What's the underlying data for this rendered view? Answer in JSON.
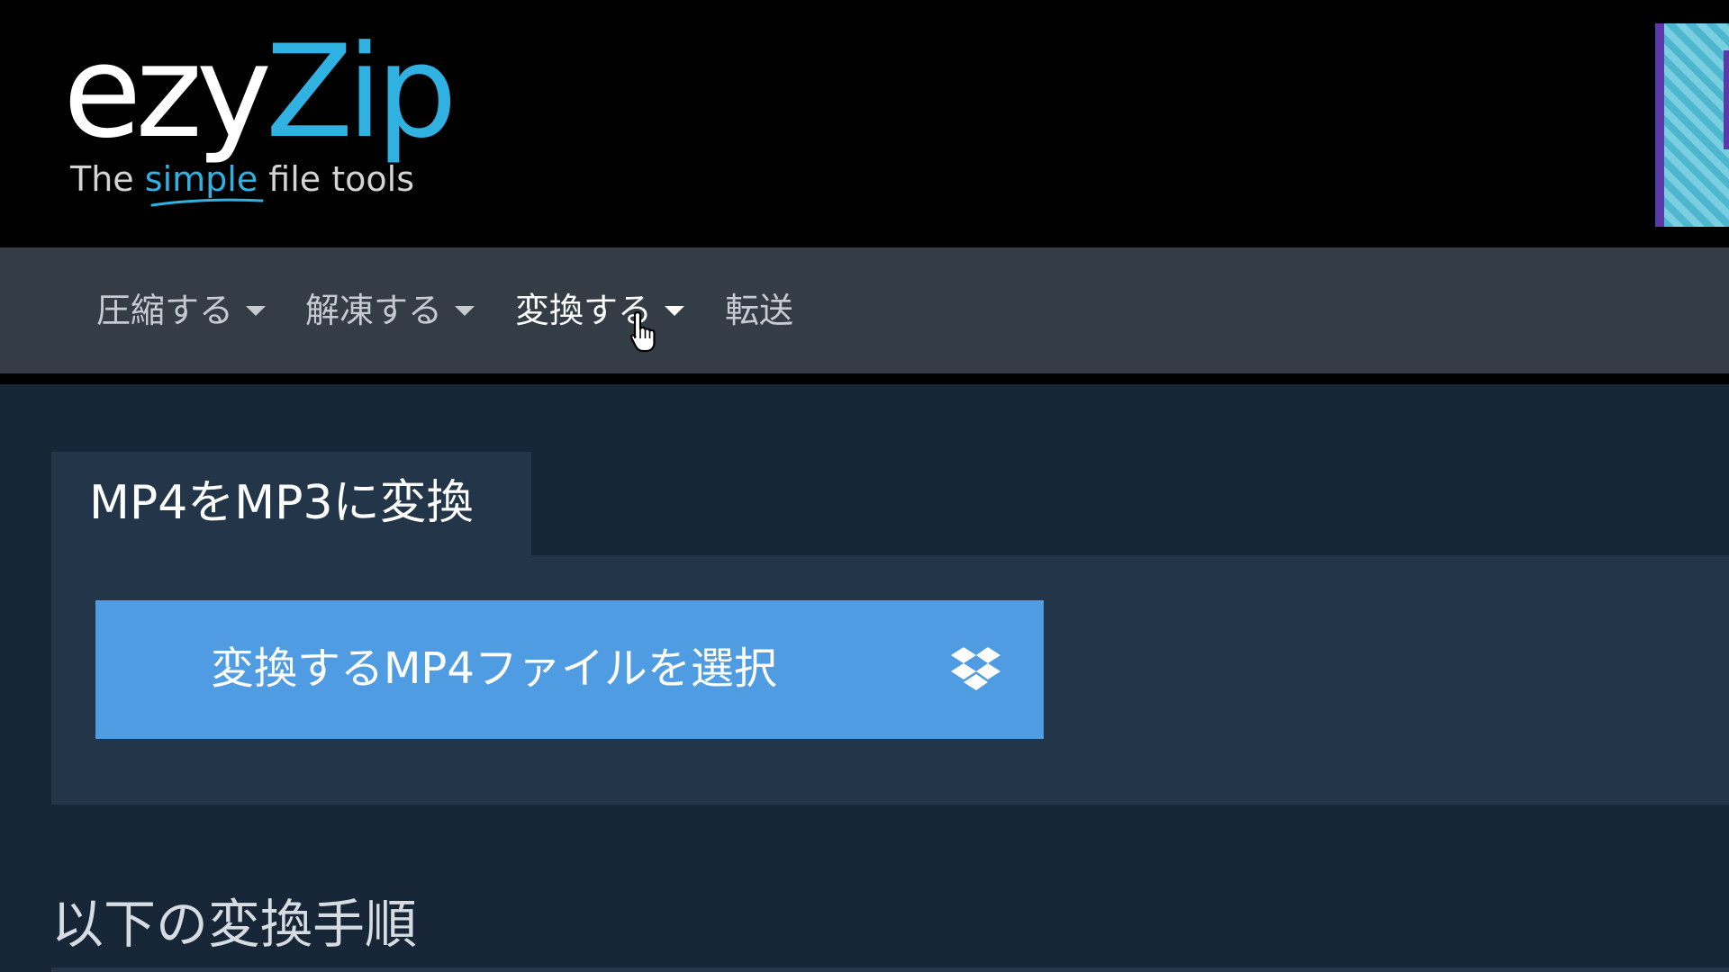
{
  "header": {
    "logo": {
      "main_left": "ezy",
      "main_right": "Zip",
      "tagline_before": "The ",
      "tagline_highlight": "simple",
      "tagline_after": " file tools"
    }
  },
  "nav": {
    "items": [
      {
        "label": "圧縮する",
        "has_dropdown": true
      },
      {
        "label": "解凍する",
        "has_dropdown": true
      },
      {
        "label": "変換する",
        "has_dropdown": true,
        "hovered": true
      },
      {
        "label": "転送",
        "has_dropdown": false
      }
    ]
  },
  "converter": {
    "tab_title": "MP4をMP3に変換",
    "select_button_label": "変換するMP4ファイルを選択",
    "cloud_icon": "dropbox-icon"
  },
  "steps": {
    "heading": "以下の変換手順"
  },
  "colors": {
    "header_bg": "#000000",
    "brand_blue": "#2fb2e2",
    "nav_bg": "#343d46",
    "page_bg": "#162636",
    "panel_bg": "#233649",
    "button_bg": "#4f9ce3"
  }
}
